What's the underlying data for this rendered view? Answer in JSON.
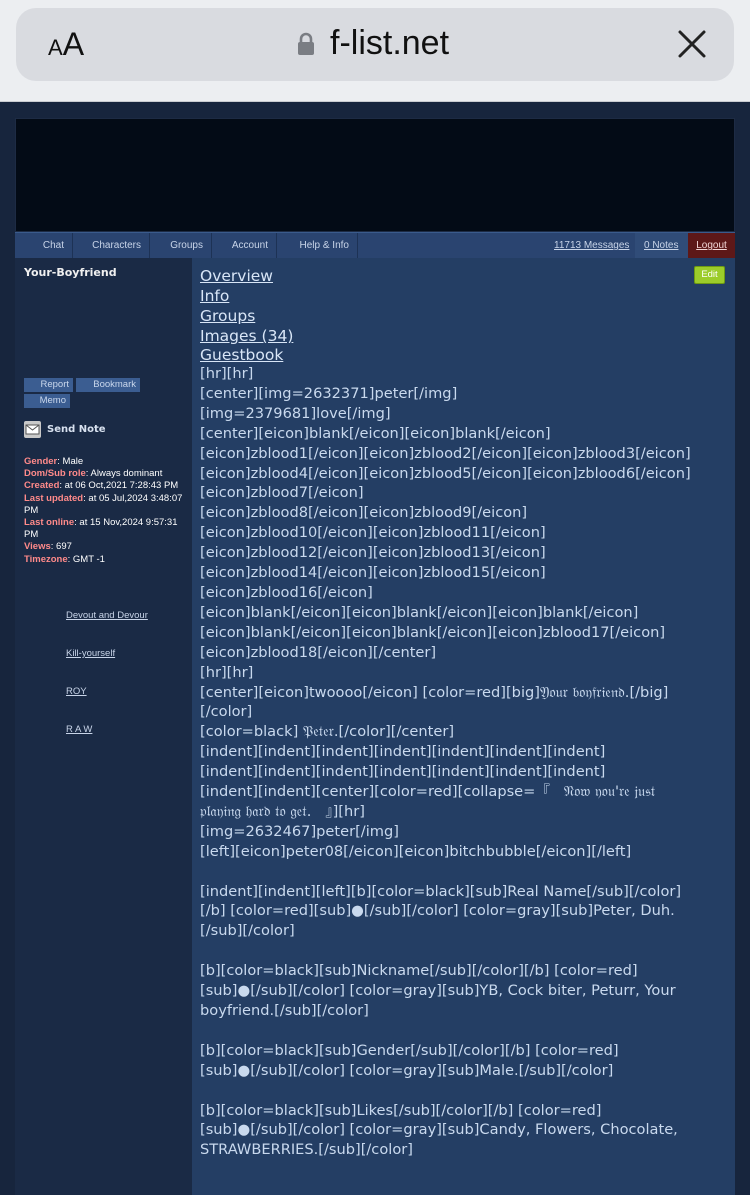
{
  "browser": {
    "text_size_button": {
      "small": "A",
      "big": "A"
    },
    "url": "f-list.net"
  },
  "nav": {
    "items": [
      "Chat",
      "Characters",
      "Groups",
      "Account",
      "Help & Info"
    ],
    "messages": "11713 Messages",
    "notes": "0 Notes",
    "logout": "Logout"
  },
  "sidebar": {
    "character_name": "Your-Boyfriend",
    "buttons": {
      "report": "Report",
      "bookmark": "Bookmark",
      "memo": "Memo"
    },
    "send_note": "Send Note",
    "info": [
      {
        "label": "Gender",
        "value": " Male"
      },
      {
        "label": "Dom/Sub role",
        "value": " Always dominant"
      },
      {
        "label": "Created",
        "value": " at 06 Oct,2021 7:28:43 PM"
      },
      {
        "label": "Last updated",
        "value": " at 05 Jul,2024 3:48:07 PM"
      },
      {
        "label": "Last online",
        "value": " at 15 Nov,2024 9:57:31 PM"
      },
      {
        "label": "Views",
        "value": " 697"
      },
      {
        "label": "Timezone",
        "value": " GMT -1"
      }
    ],
    "links": [
      "Devout and Devour",
      "Kill-yourself",
      "ROY",
      "R A W"
    ]
  },
  "main": {
    "edit": "Edit",
    "tabs": [
      "Overview",
      "Info",
      "Groups",
      "Images (34)",
      "Guestbook"
    ],
    "body": "[hr][hr]\n[center][img=2632371]peter[/img]\n[img=2379681]love[/img]\n[center][eicon]blank[/eicon][eicon]blank[/eicon]\n[eicon]zblood1[/eicon][eicon]zblood2[/eicon][eicon]zblood3[/eicon]\n[eicon]zblood4[/eicon][eicon]zblood5[/eicon][eicon]zblood6[/eicon]\n[eicon]zblood7[/eicon]\n[eicon]zblood8[/eicon][eicon]zblood9[/eicon]\n[eicon]zblood10[/eicon][eicon]zblood11[/eicon]\n[eicon]zblood12[/eicon][eicon]zblood13[/eicon]\n[eicon]zblood14[/eicon][eicon]zblood15[/eicon]\n[eicon]zblood16[/eicon]\n[eicon]blank[/eicon][eicon]blank[/eicon][eicon]blank[/eicon]\n[eicon]blank[/eicon][eicon]blank[/eicon][eicon]zblood17[/eicon]\n[eicon]zblood18[/eicon][/center]\n[hr][hr]\n[center][eicon]twoooo[/eicon] [color=red][big]𝔜𝔬𝔲𝔯 𝔟𝔬𝔶𝔣𝔯𝔦𝔢𝔫𝔡.[/big]\n[/color]\n[color=black] 𝔓𝔢𝔱𝔢𝔯.[/color][/center]\n[indent][indent][indent][indent][indent][indent][indent]\n[indent][indent][indent][indent][indent][indent][indent]\n[indent][indent][center][color=red][collapse=『   𝔑𝔬𝔴 𝔶𝔬𝔲'𝔯𝔢 𝔧𝔲𝔰𝔱\n𝔭𝔩𝔞𝔶𝔦𝔫𝔤 𝔥𝔞𝔯𝔡 𝔱𝔬 𝔤𝔢𝔱.   』][hr]\n[img=2632467]peter[/img]\n[left][eicon]peter08[/eicon][eicon]bitchbubble[/eicon][/left]\n\n[indent][indent][left][b][color=black][sub]Real Name[/sub][/color]\n[/b] [color=red][sub]●[/sub][/color] [color=gray][sub]Peter, Duh.\n[/sub][/color]\n\n[b][color=black][sub]Nickname[/sub][/color][/b] [color=red]\n[sub]●[/sub][/color] [color=gray][sub]YB, Cock biter, Peturr, Your\nboyfriend.[/sub][/color]\n\n[b][color=black][sub]Gender[/sub][/color][/b] [color=red]\n[sub]●[/sub][/color] [color=gray][sub]Male.[/sub][/color]\n\n[b][color=black][sub]Likes[/sub][/color][/b] [color=red]\n[sub]●[/sub][/color] [color=gray][sub]Candy, Flowers, Chocolate,\nSTRAWBERRIES.[/sub][/color]"
  }
}
